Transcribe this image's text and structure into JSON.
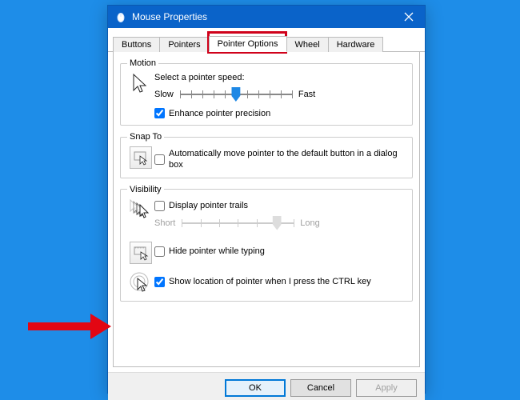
{
  "window": {
    "title": "Mouse Properties"
  },
  "tabs": {
    "buttons": "Buttons",
    "pointers": "Pointers",
    "pointer_options": "Pointer Options",
    "wheel": "Wheel",
    "hardware": "Hardware"
  },
  "motion": {
    "legend": "Motion",
    "select_speed": "Select a pointer speed:",
    "slow": "Slow",
    "fast": "Fast",
    "speed_pos": 0.5,
    "enhance": {
      "label": "Enhance pointer precision",
      "checked": true
    }
  },
  "snap": {
    "legend": "Snap To",
    "auto": {
      "label": "Automatically move pointer to the default button in a dialog box",
      "checked": false
    }
  },
  "visibility": {
    "legend": "Visibility",
    "trails": {
      "label": "Display pointer trails",
      "checked": false
    },
    "short": "Short",
    "long": "Long",
    "trail_pos": 0.85,
    "hide_typing": {
      "label": "Hide pointer while typing",
      "checked": false
    },
    "show_ctrl": {
      "label": "Show location of pointer when I press the CTRL key",
      "checked": true
    }
  },
  "buttons": {
    "ok": "OK",
    "cancel": "Cancel",
    "apply": "Apply"
  }
}
